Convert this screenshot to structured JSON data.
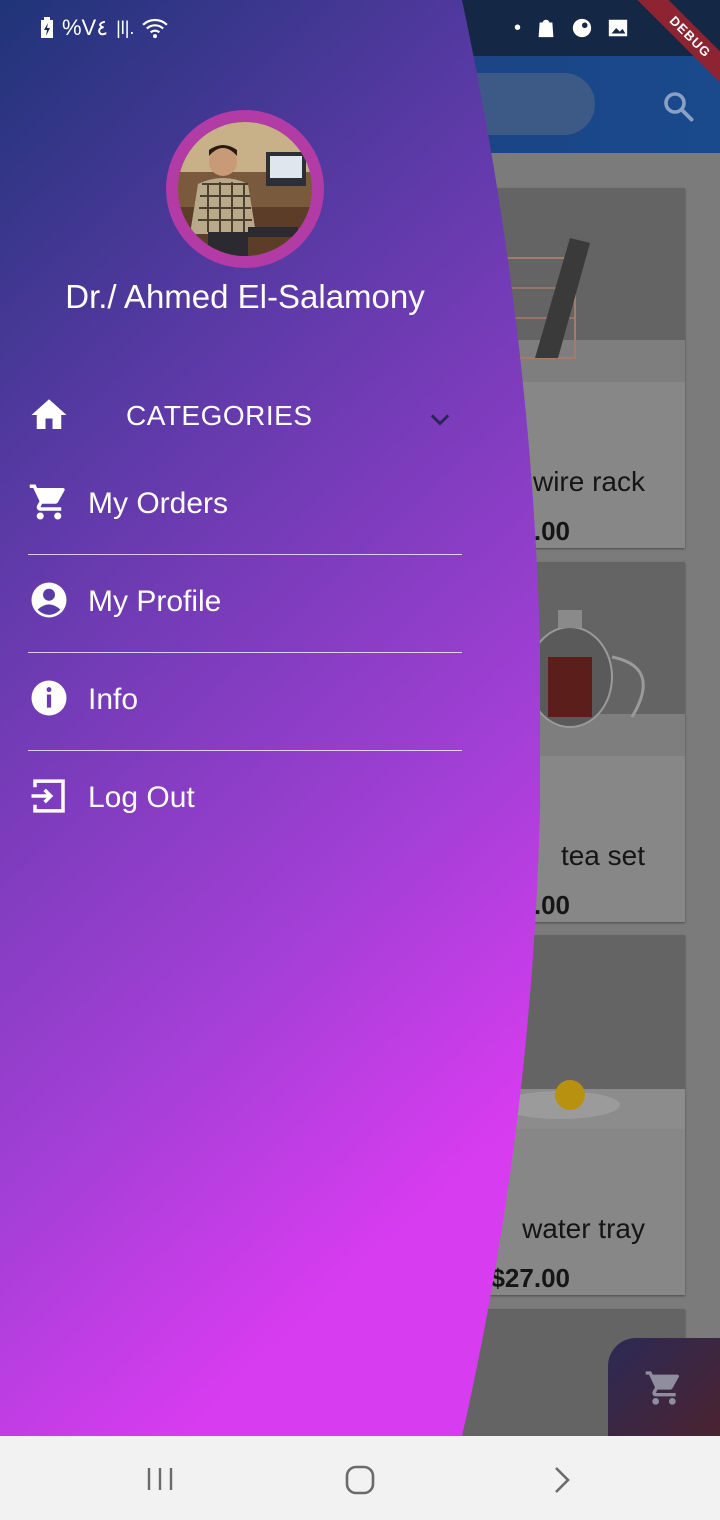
{
  "status_bar": {
    "battery_text": "%V٤",
    "signal_text": "|l|."
  },
  "debug_banner": "DEBUG",
  "drawer": {
    "user_name": "Dr./ Ahmed El-Salamony",
    "menu": [
      {
        "label": "CATEGORIES",
        "icon": "home-icon",
        "has_chevron": true
      },
      {
        "label": "My Orders",
        "icon": "cart-icon"
      },
      {
        "label": "My Profile",
        "icon": "account-circle-icon"
      },
      {
        "label": "Info",
        "icon": "info-icon"
      },
      {
        "label": "Log Out",
        "icon": "logout-icon"
      }
    ]
  },
  "products": [
    {
      "name": "wire rack",
      "price": ".00"
    },
    {
      "name": "tea set",
      "price": ".00"
    },
    {
      "name": "water tray",
      "price": "$27.00"
    }
  ],
  "colors": {
    "drawer_top": "#1f3478",
    "drawer_bottom": "#d83cf0",
    "avatar_ring": "#b23ba6",
    "cart_fab": "#3a2540"
  }
}
